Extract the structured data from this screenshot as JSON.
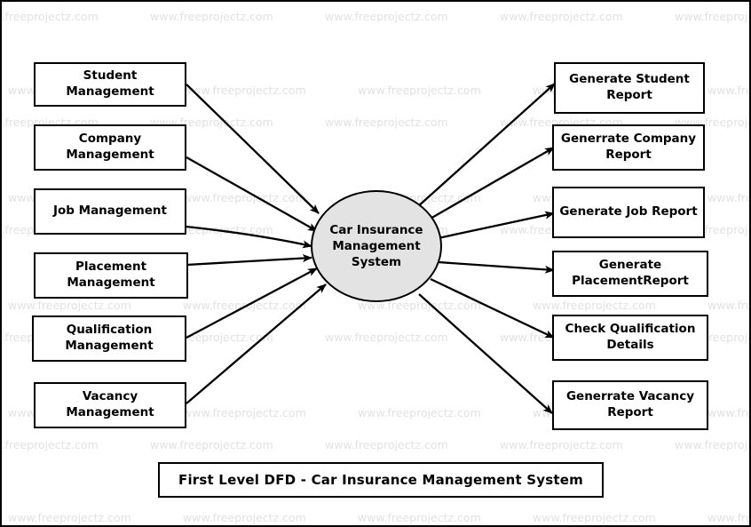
{
  "diagram": {
    "title": "First Level DFD - Car Insurance Management System",
    "process": {
      "label": "Car Insurance Management System",
      "fill": "#e3e3e3",
      "stroke": "#000000"
    },
    "inputs": [
      {
        "label": "Student Management"
      },
      {
        "label": "Company Management"
      },
      {
        "label": "Job Management"
      },
      {
        "label": "Placement Management"
      },
      {
        "label": "Qualification Management"
      },
      {
        "label": "Vacancy Management"
      }
    ],
    "outputs": [
      {
        "label": "Generate Student Report"
      },
      {
        "label": "Generrate Company Report"
      },
      {
        "label": "Generate Job Report"
      },
      {
        "label": "Generate PlacementReport"
      },
      {
        "label": "Check Qualification Details"
      },
      {
        "label": "Generrate Vacancy Report"
      }
    ]
  },
  "watermark": {
    "text": "www.freeprojectz.com",
    "color": "#e2e2e2"
  },
  "theme": {
    "background": "#ffffff",
    "line": "#000000",
    "frame": "#000000"
  }
}
